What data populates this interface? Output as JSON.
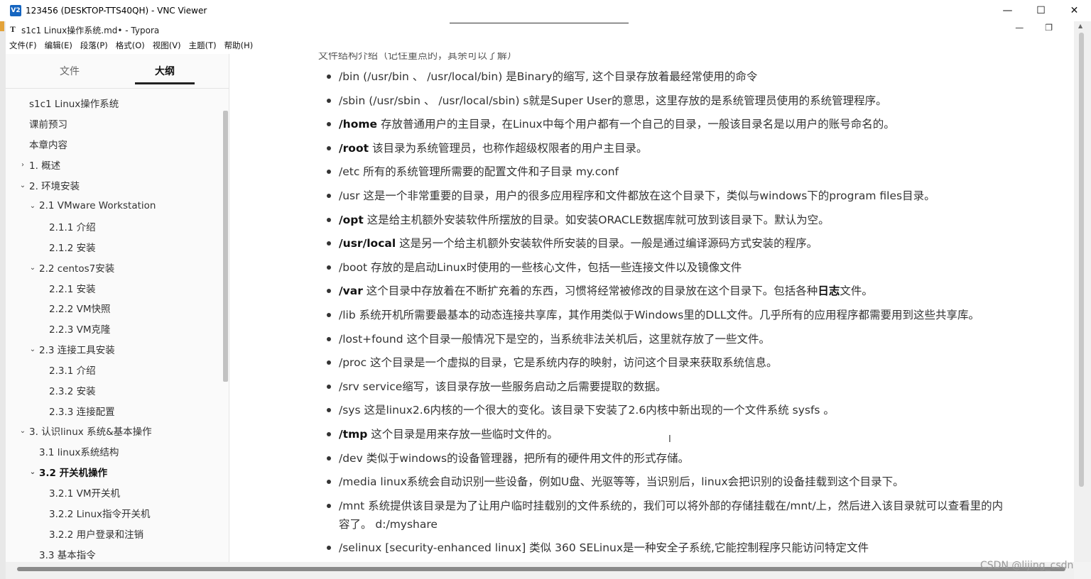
{
  "vnc": {
    "logo": "V2",
    "title": "123456 (DESKTOP-TTS40QH) - VNC Viewer",
    "minimize": "—",
    "maximize": "☐",
    "close": "✕"
  },
  "typora": {
    "icon": "T",
    "title": "s1c1 Linux操作系统.md• - Typora",
    "minimize": "—",
    "restore": "❐"
  },
  "menu": [
    "文件(F)",
    "编辑(E)",
    "段落(P)",
    "格式(O)",
    "视图(V)",
    "主题(T)",
    "帮助(H)"
  ],
  "sidebar": {
    "tabs": [
      "文件",
      "大纲"
    ],
    "active_tab": "大纲",
    "outline": [
      {
        "label": "s1c1 Linux操作系统",
        "chevron": ""
      },
      {
        "label": "课前预习",
        "chevron": ""
      },
      {
        "label": "本章内容",
        "chevron": ""
      },
      {
        "label": "1. 概述",
        "chevron": "›"
      },
      {
        "label": "2. 环境安装",
        "chevron": "⌄"
      },
      {
        "label": "2.1 VMware Workstation",
        "chevron": "⌄"
      },
      {
        "label": "2.1.1 介绍",
        "chevron": ""
      },
      {
        "label": "2.1.2 安装",
        "chevron": ""
      },
      {
        "label": "2.2 centos7安装",
        "chevron": "⌄"
      },
      {
        "label": "2.2.1 安装",
        "chevron": ""
      },
      {
        "label": "2.2.2 VM快照",
        "chevron": ""
      },
      {
        "label": "2.2.3 VM克隆",
        "chevron": ""
      },
      {
        "label": "2.3 连接工具安装",
        "chevron": "⌄"
      },
      {
        "label": "2.3.1 介绍",
        "chevron": ""
      },
      {
        "label": "2.3.2 安装",
        "chevron": ""
      },
      {
        "label": "2.3.3 连接配置",
        "chevron": ""
      },
      {
        "label": "3. 认识linux 系统&基本操作",
        "chevron": "⌄"
      },
      {
        "label": "3.1 linux系统结构",
        "chevron": ""
      },
      {
        "label": "3.2 开关机操作",
        "chevron": "⌄"
      },
      {
        "label": "3.2.1 VM开关机",
        "chevron": ""
      },
      {
        "label": "3.2.2 Linux指令开关机",
        "chevron": ""
      },
      {
        "label": "3.2.2 用户登录和注销",
        "chevron": ""
      },
      {
        "label": "3.3 基本指令",
        "chevron": ""
      }
    ]
  },
  "content": {
    "cut_heading": "文件结构介绍（记住重点的，其余可以了解）",
    "bullets": [
      {
        "bold": "",
        "text": "/bin  (/usr/bin 、 /usr/local/bin) 是Binary的缩写, 这个目录存放着最经常使用的命令"
      },
      {
        "bold": "",
        "text": "/sbin  (/usr/sbin 、 /usr/local/sbin) s就是Super User的意思，这里存放的是系统管理员使用的系统管理程序。"
      },
      {
        "bold": "/home",
        "text": "  存放普通用户的主目录，在Linux中每个用户都有一个自己的目录，一般该目录名是以用户的账号命名的。"
      },
      {
        "bold": "/root",
        "text": "  该目录为系统管理员，也称作超级权限者的用户主目录。"
      },
      {
        "bold": "",
        "text": "/etc 所有的系统管理所需要的配置文件和子目录 my.conf"
      },
      {
        "bold": "",
        "text": "/usr   这是一个非常重要的目录，用户的很多应用程序和文件都放在这个目录下，类似与windows下的program files目录。"
      },
      {
        "bold": "/opt",
        "text": "  这是给主机额外安装软件所摆放的目录。如安装ORACLE数据库就可放到该目录下。默认为空。"
      },
      {
        "bold": "/usr/local",
        "text": "  这是另一个给主机额外安装软件所安装的目录。一般是通过编译源码方式安装的程序。"
      },
      {
        "bold": "",
        "text": "/boot 存放的是启动Linux时使用的一些核心文件，包括一些连接文件以及镜像文件"
      },
      {
        "bold": "/var",
        "text": " 这个目录中存放着在不断扩充着的东西，习惯将经常被修改的目录放在这个目录下。包括各种",
        "bold2": "日志",
        "tail": "文件。"
      },
      {
        "bold": "",
        "text": "/lib 系统开机所需要最基本的动态连接共享库，其作用类似于Windows里的DLL文件。几乎所有的应用程序都需要用到这些共享库。"
      },
      {
        "bold": "",
        "text": "/lost+found 这个目录一般情况下是空的，当系统非法关机后，这里就存放了一些文件。"
      },
      {
        "bold": "",
        "text": "/proc 这个目录是一个虚拟的目录，它是系统内存的映射，访问这个目录来获取系统信息。"
      },
      {
        "bold": "",
        "text": "/srv service缩写，该目录存放一些服务启动之后需要提取的数据。"
      },
      {
        "bold": "",
        "text": "/sys 这是linux2.6内核的一个很大的变化。该目录下安装了2.6内核中新出现的一个文件系统 sysfs 。"
      },
      {
        "bold": "/tmp",
        "text": " 这个目录是用来存放一些临时文件的。"
      },
      {
        "bold": "",
        "text": "/dev  类似于windows的设备管理器，把所有的硬件用文件的形式存储。"
      },
      {
        "bold": "",
        "text": "/media linux系统会自动识别一些设备，例如U盘、光驱等等，当识别后，linux会把识别的设备挂载到这个目录下。"
      },
      {
        "bold": "",
        "text": "/mnt 系统提供该目录是为了让用户临时挂载别的文件系统的，我们可以将外部的存储挂载在/mnt/上，然后进入该目录就可以查看里的内容了。 d:/myshare"
      },
      {
        "bold": "",
        "text": "/selinux  [security-enhanced linux]  类似 360 SELinux是一种安全子系统,它能控制程序只能访问特定文件"
      }
    ]
  },
  "watermark": "CSDN @lijing_csdn"
}
